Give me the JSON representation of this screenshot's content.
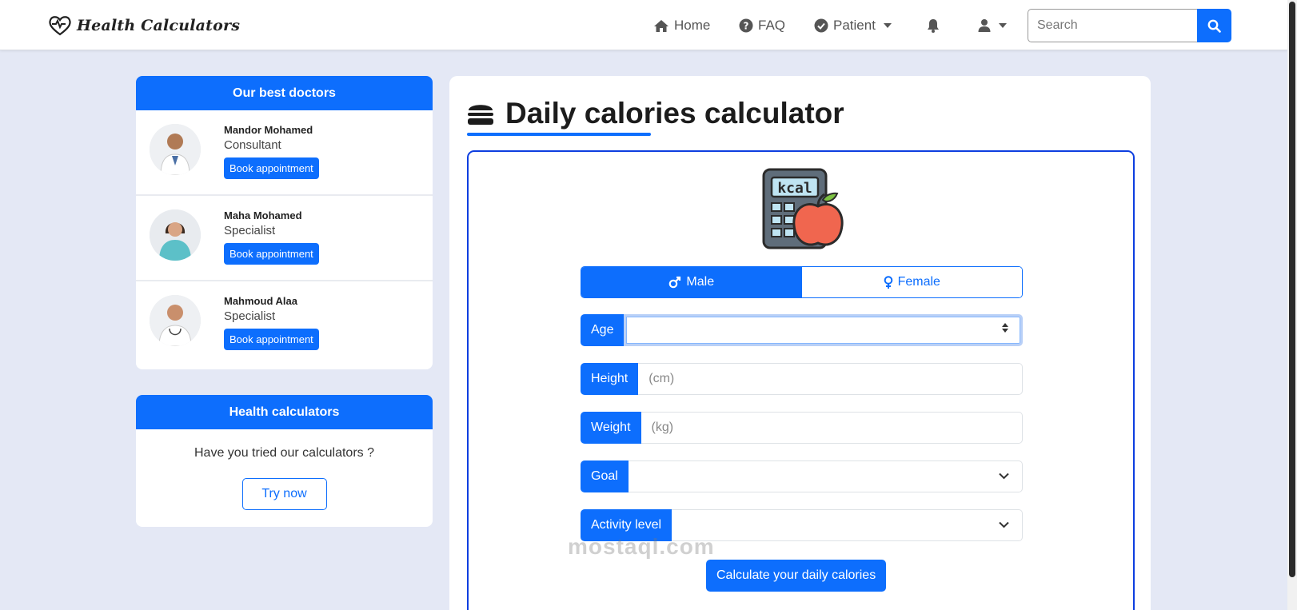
{
  "navbar": {
    "brand": "Health Calculators",
    "home": "Home",
    "faq": "FAQ",
    "patient": "Patient",
    "search_placeholder": "Search"
  },
  "doctors": {
    "title": "Our best doctors",
    "items": [
      {
        "name": "Mandor Mohamed",
        "role": "Consultant",
        "button": "Book appointment"
      },
      {
        "name": "Maha Mohamed",
        "role": "Specialist",
        "button": "Book appointment"
      },
      {
        "name": "Mahmoud Alaa",
        "role": "Specialist",
        "button": "Book appointment"
      }
    ]
  },
  "calculators_card": {
    "title": "Health calculators",
    "text": "Have you tried our calculators ?",
    "button": "Try now"
  },
  "main": {
    "title": "Daily calories calculator",
    "kcal_label": "kcal",
    "gender": {
      "male": "Male",
      "female": "Female",
      "selected": "Male"
    },
    "fields": {
      "age_label": "Age",
      "age_value": "",
      "height_label": "Height",
      "height_placeholder": "(cm)",
      "weight_label": "Weight",
      "weight_placeholder": "(kg)",
      "goal_label": "Goal",
      "activity_label": "Activity level"
    },
    "submit": "Calculate your daily calories"
  },
  "watermark": "mostaql.com",
  "colors": {
    "primary": "#0d6efd",
    "background": "#e4e8f5"
  }
}
